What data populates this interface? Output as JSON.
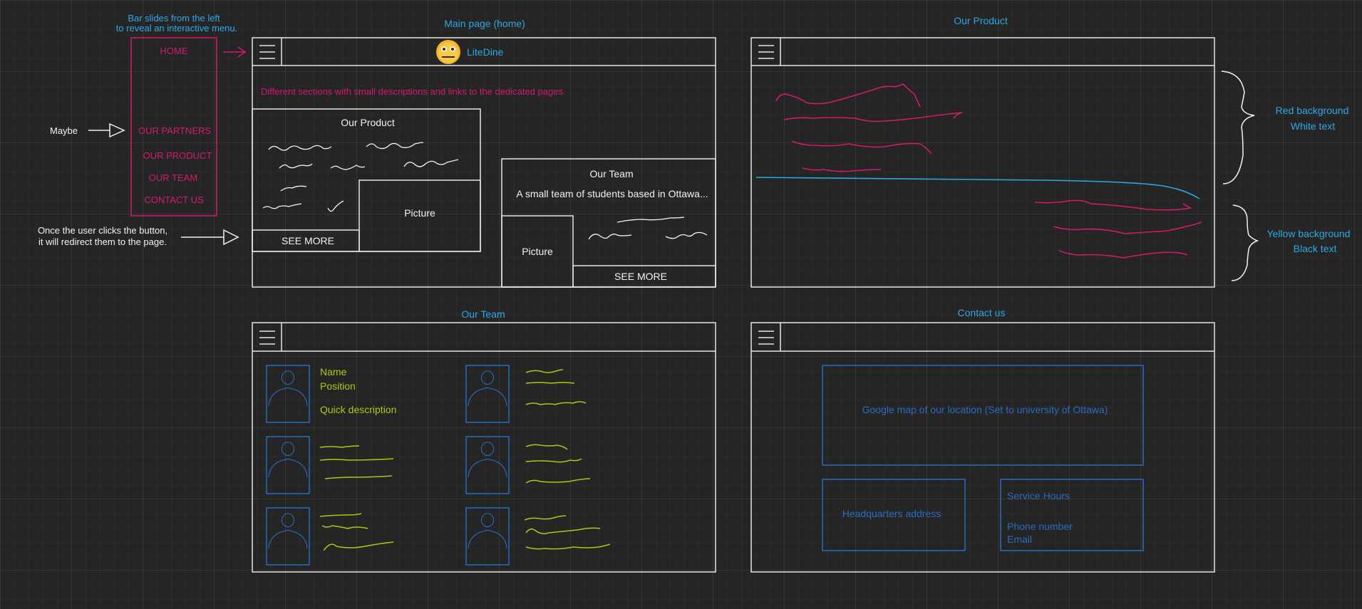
{
  "colors": {
    "frame": "#e6e6e6",
    "pink": "#d21a6e",
    "blue_label": "#2fa8e6",
    "blue_box": "#2a6bbf",
    "lime": "#b2c417",
    "white": "#f2f2f2",
    "sky_line": "#2aa8e0"
  },
  "annotations": {
    "menu_note_line1": "Bar slides from the left",
    "menu_note_line2": "to reveal an interactive menu.",
    "maybe": "Maybe",
    "redirect_note_line1": "Once the user clicks the button,",
    "redirect_note_line2": "it will redirect them to the page.",
    "red_bg": "Red background",
    "white_text": "White text",
    "yellow_bg": "Yellow background",
    "black_text": "Black text"
  },
  "side_menu": {
    "items": [
      "HOME",
      "OUR PARTNERS",
      "OUR PRODUCT",
      "OUR TEAM",
      "CONTACT US"
    ]
  },
  "home": {
    "title": "Main page (home)",
    "logo_icon": "emoji-face-icon",
    "brand": "LiteDine",
    "intro": "Different sections with small descriptions and links to the dedicated pages.",
    "product_title": "Our Product",
    "product_picture": "Picture",
    "product_see_more": "SEE MORE",
    "team_title": "Our Team",
    "team_text": "A small team of students based in Ottawa...",
    "team_picture": "Picture",
    "team_see_more": "SEE MORE"
  },
  "product": {
    "title": "Our Product"
  },
  "team": {
    "title": "Our Team",
    "name": "Name",
    "position": "Position",
    "description": "Quick description"
  },
  "contact": {
    "title": "Contact us",
    "map": "Google map of our location (Set to university of Ottawa)",
    "hq": "Headquarters address",
    "hours": "Service Hours",
    "phone": "Phone number",
    "email": "Email"
  }
}
